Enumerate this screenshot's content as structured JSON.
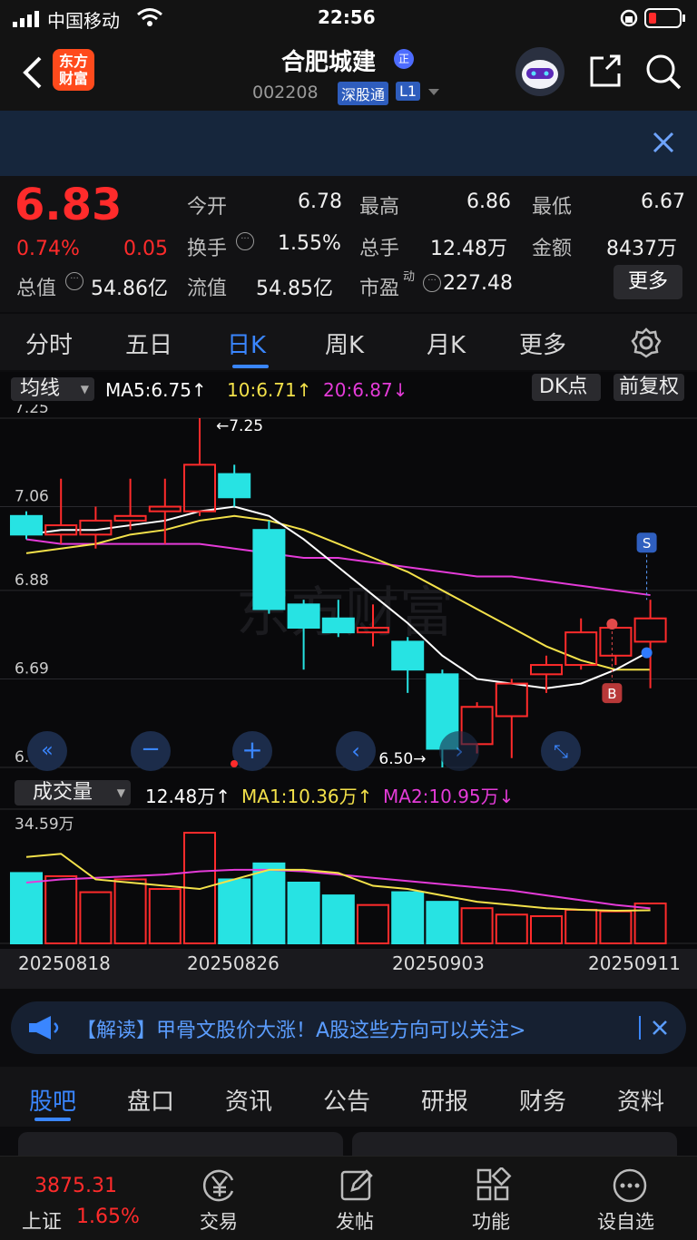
{
  "status_bar": {
    "carrier": "中国移动",
    "time": "22:56"
  },
  "header": {
    "brand": "东方\n财富",
    "stock_name": "合肥城建",
    "stock_badge": "正",
    "stock_code": "002208",
    "tag_sz": "深股通",
    "tag_l1": "L1"
  },
  "quote": {
    "price": "6.83",
    "change_pct": "0.74%",
    "change": "0.05",
    "labels": {
      "open": "今开",
      "high": "最高",
      "low": "最低",
      "turnover": "换手",
      "volume": "总手",
      "amount": "金额",
      "total_value": "总值",
      "float_value": "流值",
      "pe": "市盈",
      "pe_sup": "动"
    },
    "values": {
      "open": "6.78",
      "high": "6.86",
      "low": "6.67",
      "turnover": "1.55%",
      "volume": "12.48万",
      "amount": "8437万",
      "total_value": "54.86亿",
      "float_value": "54.85亿",
      "pe": "227.48"
    },
    "more_button": "更多"
  },
  "tabs": [
    "分时",
    "五日",
    "日K",
    "周K",
    "月K",
    "更多"
  ],
  "chart_controls": {
    "ma_select": "均线",
    "ma5": "MA5:6.75↑",
    "ma10": "10:6.71↑",
    "ma20": "20:6.87↓",
    "dk_button": "DK点",
    "adjust_button": "前复权"
  },
  "chart_labels": {
    "y_ticks": [
      "7.25",
      "7.06",
      "6.88",
      "6.69",
      "6.50"
    ],
    "max_marker": "←7.25",
    "min_marker": "6.50→",
    "s_marker": "S",
    "b_marker": "B",
    "watermark": "东方财富"
  },
  "volume_controls": {
    "select": "成交量",
    "vol": "12.48万↑",
    "ma1": "MA1:10.36万↑",
    "ma2": "MA2:10.95万↓",
    "max_label": "34.59万"
  },
  "dates": [
    "20250818",
    "20250826",
    "20250903",
    "20250911"
  ],
  "news": {
    "text": "【解读】甲骨文股价大涨！A股这些方向可以关注>"
  },
  "subtabs": [
    "股吧",
    "盘口",
    "资讯",
    "公告",
    "研报",
    "财务",
    "资料"
  ],
  "bottom": {
    "index_value": "3875.31",
    "index_name": "上证",
    "index_change": "1.65%",
    "items": [
      "交易",
      "发帖",
      "功能",
      "设自选"
    ]
  },
  "chart_data": {
    "type": "candlestick",
    "ylim": [
      6.5,
      7.25
    ],
    "candles": [
      {
        "o": 7.04,
        "c": 7.0,
        "h": 7.05,
        "l": 6.99
      },
      {
        "o": 7.0,
        "c": 7.02,
        "h": 7.12,
        "l": 6.98
      },
      {
        "o": 7.0,
        "c": 7.03,
        "h": 7.06,
        "l": 6.97
      },
      {
        "o": 7.03,
        "c": 7.04,
        "h": 7.12,
        "l": 7.01
      },
      {
        "o": 7.05,
        "c": 7.06,
        "h": 7.12,
        "l": 6.98
      },
      {
        "o": 7.05,
        "c": 7.15,
        "h": 7.25,
        "l": 7.04
      },
      {
        "o": 7.13,
        "c": 7.08,
        "h": 7.15,
        "l": 7.06
      },
      {
        "o": 7.01,
        "c": 6.84,
        "h": 7.03,
        "l": 6.83
      },
      {
        "o": 6.85,
        "c": 6.8,
        "h": 6.86,
        "l": 6.71
      },
      {
        "o": 6.82,
        "c": 6.79,
        "h": 6.86,
        "l": 6.78
      },
      {
        "o": 6.79,
        "c": 6.8,
        "h": 6.85,
        "l": 6.76
      },
      {
        "o": 6.77,
        "c": 6.71,
        "h": 6.78,
        "l": 6.66
      },
      {
        "o": 6.7,
        "c": 6.54,
        "h": 6.71,
        "l": 6.5
      },
      {
        "o": 6.55,
        "c": 6.63,
        "h": 6.64,
        "l": 6.53
      },
      {
        "o": 6.61,
        "c": 6.68,
        "h": 6.69,
        "l": 6.52
      },
      {
        "o": 6.7,
        "c": 6.72,
        "h": 6.74,
        "l": 6.66
      },
      {
        "o": 6.72,
        "c": 6.79,
        "h": 6.82,
        "l": 6.71
      },
      {
        "o": 6.74,
        "c": 6.8,
        "h": 6.81,
        "l": 6.72
      },
      {
        "o": 6.77,
        "c": 6.82,
        "h": 6.86,
        "l": 6.67
      }
    ],
    "ma5": [
      7.0,
      7.01,
      7.01,
      7.02,
      7.03,
      7.05,
      7.06,
      7.04,
      6.99,
      6.93,
      6.87,
      6.81,
      6.74,
      6.69,
      6.68,
      6.67,
      6.68,
      6.71,
      6.75
    ],
    "ma10": [
      6.96,
      6.97,
      6.98,
      7.0,
      7.01,
      7.03,
      7.04,
      7.03,
      7.01,
      6.98,
      6.95,
      6.92,
      6.88,
      6.84,
      6.8,
      6.76,
      6.73,
      6.71,
      6.71
    ],
    "ma20": [
      6.99,
      6.98,
      6.98,
      6.98,
      6.98,
      6.98,
      6.97,
      6.96,
      6.95,
      6.95,
      6.94,
      6.93,
      6.92,
      6.91,
      6.91,
      6.9,
      6.89,
      6.88,
      6.87
    ],
    "volumes": [
      22,
      21,
      16,
      20,
      17,
      34.59,
      20,
      25,
      19,
      15,
      12,
      16,
      13,
      11,
      9,
      8.5,
      10.5,
      10,
      12.48
    ],
    "vol_ma1": [
      27,
      28,
      20,
      19,
      18,
      17,
      20,
      23,
      23,
      22,
      18,
      17,
      15,
      13,
      12,
      11,
      10.5,
      10.2,
      10.36
    ],
    "vol_ma2": [
      19,
      20,
      20.5,
      21,
      21.5,
      22.5,
      23,
      23,
      22.5,
      21.5,
      20.5,
      19.5,
      18.5,
      17.5,
      16.5,
      15,
      13.5,
      12,
      10.95
    ],
    "vol_ylim": [
      0,
      34.59
    ]
  }
}
